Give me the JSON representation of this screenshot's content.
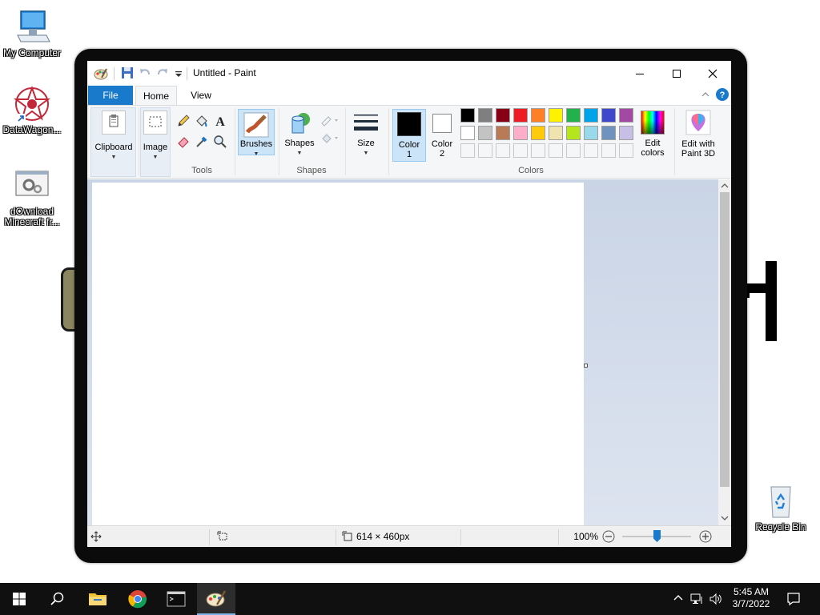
{
  "desktop": {
    "icons": [
      {
        "label": "My Computer",
        "icon": "computer-icon"
      },
      {
        "label": "DataWagon...",
        "icon": "datawagon-icon"
      },
      {
        "label": "dOwnload Minecraft fr...",
        "icon": "settings-file-icon"
      },
      {
        "label": "Recycle Bin",
        "icon": "recycle-bin-icon"
      }
    ]
  },
  "window": {
    "title": "Untitled - Paint",
    "quick_access": [
      "paint-app-icon",
      "save-icon",
      "undo-icon",
      "redo-icon",
      "customize-dropdown-icon"
    ],
    "controls": {
      "minimize": "minimize-icon",
      "maximize": "maximize-icon",
      "close": "close-icon"
    }
  },
  "ribbon": {
    "tabs": {
      "file": "File",
      "home": "Home",
      "view": "View"
    },
    "groups": {
      "clipboard": {
        "label": "Clipboard"
      },
      "image": {
        "label": "Image"
      },
      "tools": {
        "label": "Tools"
      },
      "brushes": {
        "label": "Brushes"
      },
      "shapes": {
        "label": "Shapes",
        "button": "Shapes"
      },
      "size": {
        "label": "Size"
      },
      "color1": {
        "label": "Color",
        "sub": "1"
      },
      "color2": {
        "label": "Color",
        "sub": "2"
      },
      "colors": {
        "label": "Colors"
      },
      "edit_colors": {
        "line1": "Edit",
        "line2": "colors"
      },
      "paint3d": {
        "line1": "Edit with",
        "line2": "Paint 3D"
      }
    },
    "palette_row1": [
      "#000000",
      "#7f7f7f",
      "#880015",
      "#ed1c24",
      "#ff7f27",
      "#fff200",
      "#22b14c",
      "#00a2e8",
      "#3f48cc",
      "#a349a4"
    ],
    "palette_row2": [
      "#ffffff",
      "#c3c3c3",
      "#b97a57",
      "#ffaec9",
      "#ffc90e",
      "#efe4b0",
      "#b5e61d",
      "#99d9ea",
      "#7092be",
      "#c8bfe7"
    ],
    "palette_row3": [
      "#f5f6f7",
      "#f5f6f7",
      "#f5f6f7",
      "#f5f6f7",
      "#f5f6f7",
      "#f5f6f7",
      "#f5f6f7",
      "#f5f6f7",
      "#f5f6f7",
      "#f5f6f7"
    ],
    "color1_value": "#000000",
    "color2_value": "#ffffff"
  },
  "statusbar": {
    "canvas_size": "614 × 460px",
    "zoom": "100%",
    "zoom_slider_position": 0.5
  },
  "taskbar": {
    "time": "5:45 AM",
    "date": "3/7/2022"
  }
}
